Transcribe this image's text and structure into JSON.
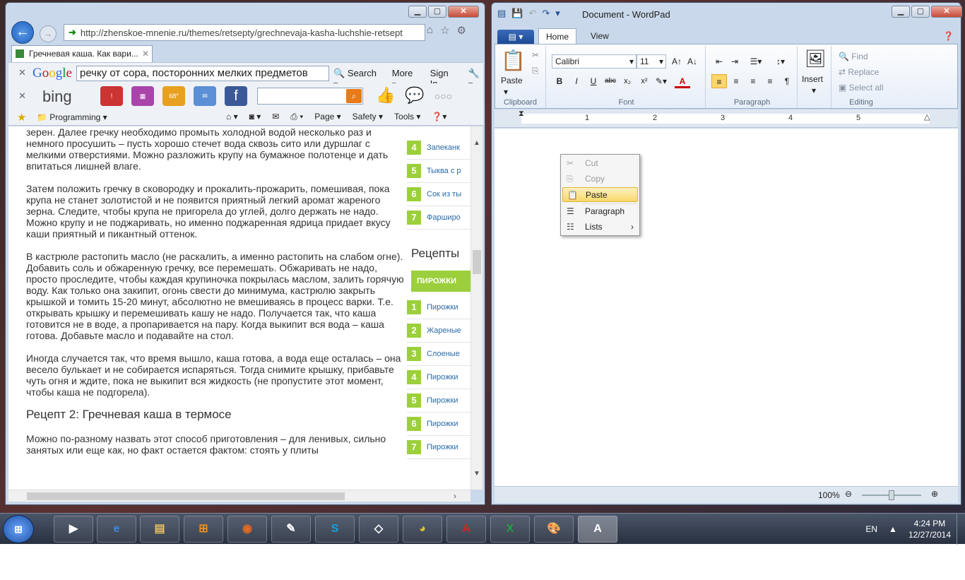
{
  "ie": {
    "address": "http://zhenskoe-mnenie.ru/themes/retsepty/grechnevaja-kasha-luchshie-retsept",
    "tab_title": "Гречневая каша. Как вари...",
    "google": {
      "logo": "Google",
      "query": "речку от сора, посторонних мелких предметов",
      "search_label": "Search",
      "more_label": "More",
      "signin_label": "Sign In"
    },
    "bing": {
      "logo": "bing",
      "weather": "68°"
    },
    "cmd": {
      "favorites": "Programming",
      "page": "Page",
      "safety": "Safety",
      "tools": "Tools"
    },
    "article": {
      "p1": "зерен. Далее гречку необходимо промыть холодной водой несколько раз и немного просушить – пусть хорошо стечет вода сквозь сито или дуршлаг с мелкими отверстиями. Можно разложить крупу на бумажное полотенце и дать впитаться лишней влаге.",
      "p2": "Затем положить гречку в сковородку и прокалить-прожарить, помешивая, пока крупа не станет золотистой и не появится приятный легкий аромат жареного зерна. Следите, чтобы крупа не пригорела до углей, долго держать не надо. Можно крупу и не поджаривать, но именно поджаренная ядрица придает вкусу каши приятный и пикантный оттенок.",
      "p3": "В кастрюле растопить масло (не раскалить, а именно растопить на слабом огне). Добавить соль и обжаренную гречку, все перемешать. Обжаривать не надо, просто проследите, чтобы каждая крупиночка покрылась маслом, залить горячую воду. Как только она закипит, огонь свести до минимума, кастрюлю закрыть крышкой и томить 15-20 минут, абсолютно не вмешиваясь в процесс варки. Т.е. открывать крышку и перемешивать кашу не надо. Получается так, что каша готовится не в воде, а пропаривается на пару. Когда выкипит вся вода – каша готова. Добавьте масло и подавайте на стол.",
      "p4": "Иногда случается так, что время вышло, каша готова, а вода еще осталась – она весело булькает и не собирается испаряться. Тогда снимите крышку, прибавьте чуть огня и ждите, пока не выкипит вся жидкость (не пропустите этот момент, чтобы каша не подгорела).",
      "h3": "Рецепт 2: Гречневая каша в термосе",
      "p5": "Можно по-разному назвать этот способ приготовления – для ленивых, сильно занятых или еще как, но факт остается фактом: стоять у плиты"
    },
    "sidebar": {
      "top": [
        {
          "num": "4",
          "label": "Запеканк"
        },
        {
          "num": "5",
          "label": "Тыква с р"
        },
        {
          "num": "6",
          "label": "Сок из ты"
        },
        {
          "num": "7",
          "label": "Фарширо"
        }
      ],
      "heading": "Рецепты",
      "pill": "ПИРОЖКИ",
      "bottom": [
        {
          "num": "1",
          "label": "Пирожки"
        },
        {
          "num": "2",
          "label": "Жареные"
        },
        {
          "num": "3",
          "label": "Слоеные"
        },
        {
          "num": "4",
          "label": "Пирожки"
        },
        {
          "num": "5",
          "label": "Пирожки"
        },
        {
          "num": "6",
          "label": "Пирожки"
        },
        {
          "num": "7",
          "label": "Пирожки"
        }
      ]
    }
  },
  "wordpad": {
    "title": "Document - WordPad",
    "tabs": {
      "home": "Home",
      "view": "View"
    },
    "clipboard": {
      "paste": "Paste",
      "label": "Clipboard"
    },
    "font": {
      "name": "Calibri",
      "size": "11",
      "label": "Font"
    },
    "paragraph": {
      "label": "Paragraph"
    },
    "insert": {
      "label": "Insert"
    },
    "editing": {
      "find": "Find",
      "replace": "Replace",
      "select_all": "Select all",
      "label": "Editing"
    },
    "ruler": [
      "1",
      "2",
      "3",
      "4",
      "5"
    ],
    "zoom": "100%"
  },
  "context_menu": {
    "cut": "Cut",
    "copy": "Copy",
    "paste": "Paste",
    "paragraph": "Paragraph",
    "lists": "Lists"
  },
  "taskbar": {
    "lang": "EN",
    "time": "4:24 PM",
    "date": "12/27/2014"
  },
  "colors": {
    "green_accent": "#9ccf3c",
    "link": "#2a6aa8",
    "highlight": "#f8d96a"
  }
}
